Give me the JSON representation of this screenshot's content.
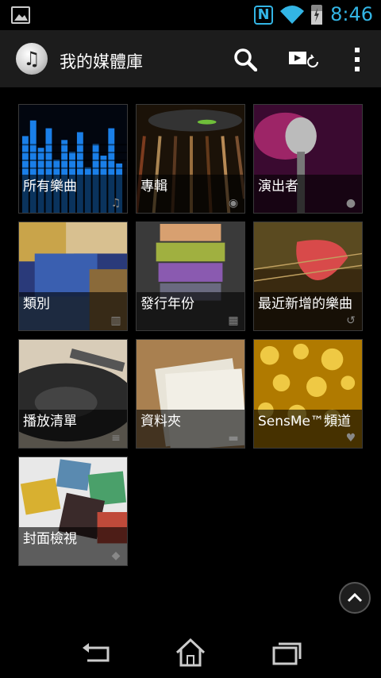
{
  "status_bar": {
    "time": "8:46",
    "icons": [
      "image-notification-icon",
      "nfc-icon",
      "wifi-icon",
      "battery-charging-icon"
    ],
    "nfc_glyph": "N"
  },
  "action_bar": {
    "title": "我的媒體庫",
    "icons": [
      "music-note-icon",
      "search-icon",
      "throw-to-device-icon",
      "overflow-menu-icon"
    ],
    "app_glyph": "♫"
  },
  "tiles": [
    {
      "label": "所有樂曲",
      "icon": "music-note-icon",
      "glyph": "♫"
    },
    {
      "label": "專輯",
      "icon": "disc-icon",
      "glyph": "◉"
    },
    {
      "label": "演出者",
      "icon": "person-icon",
      "glyph": "●"
    },
    {
      "label": "類別",
      "icon": "genre-icon",
      "glyph": "▥"
    },
    {
      "label": "發行年份",
      "icon": "calendar-icon",
      "glyph": "▦"
    },
    {
      "label": "最近新增的樂曲",
      "icon": "recent-history-icon",
      "glyph": "↺"
    },
    {
      "label": "播放清單",
      "icon": "playlist-icon",
      "glyph": "≡"
    },
    {
      "label": "資料夾",
      "icon": "folder-icon",
      "glyph": "▬"
    },
    {
      "label": "SensMe™頻道",
      "icon": "sensme-icon",
      "glyph": "♥"
    },
    {
      "label": "封面檢視",
      "icon": "cover-view-icon",
      "glyph": "◆"
    }
  ],
  "scroll_top": {
    "icon": "chevron-up-icon"
  },
  "nav_bar": {
    "icons": [
      "back-icon",
      "home-icon",
      "recent-apps-icon"
    ]
  },
  "colors": {
    "accent": "#33b5e5",
    "action_bar": "#1c1c1c",
    "background": "#000000"
  }
}
